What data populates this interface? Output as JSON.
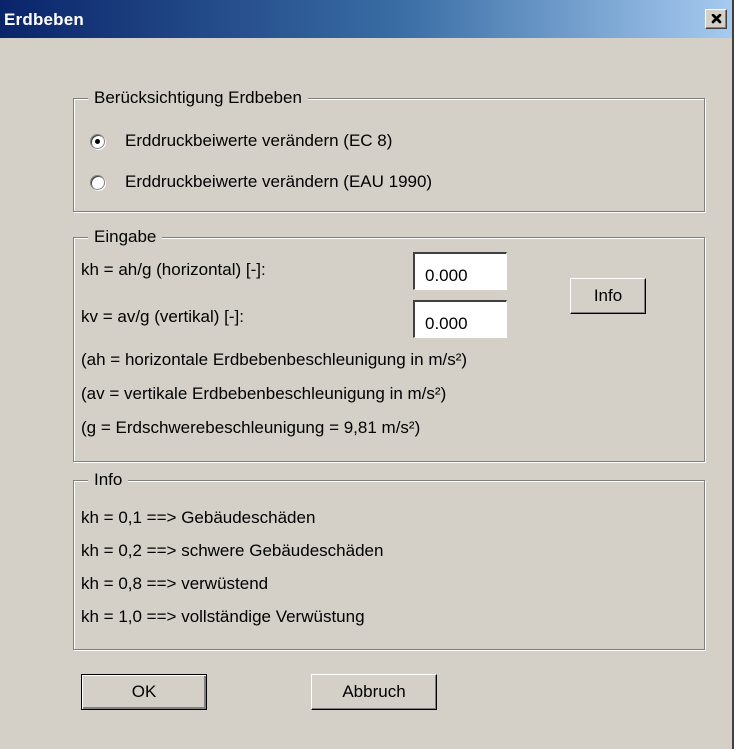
{
  "window": {
    "title": "Erdbeben"
  },
  "earthquake_group": {
    "legend": "Berücksichtigung Erdbeben",
    "options": [
      {
        "label": "Erddruckbeiwerte verändern (EC 8)",
        "selected": true
      },
      {
        "label": "Erddruckbeiwerte verändern (EAU 1990)",
        "selected": false
      }
    ]
  },
  "input_group": {
    "legend": "Eingabe",
    "kh_label": "kh = ah/g (horizontal) [-]:",
    "kh_value": "0.000",
    "kv_label": "kv = av/g (vertikal) [-]:",
    "kv_value": "0.000",
    "info_button": "Info",
    "notes": [
      "(ah = horizontale Erdbebenbeschleunigung in  m/s²)",
      "(av = vertikale Erdbebenbeschleunigung in  m/s²)",
      "(g = Erdschwerebeschleunigung = 9,81 m/s²)"
    ]
  },
  "info_group": {
    "legend": "Info",
    "lines": [
      "kh = 0,1 ==> Gebäudeschäden",
      "kh = 0,2 ==> schwere Gebäudeschäden",
      "kh = 0,8 ==> verwüstend",
      "kh = 1,0 ==> vollständige Verwüstung"
    ]
  },
  "footer": {
    "ok_label": "OK",
    "cancel_label": "Abbruch"
  },
  "colors": {
    "face": "#d4d0c8",
    "title_start": "#0a246a",
    "title_end": "#a6caf0"
  }
}
